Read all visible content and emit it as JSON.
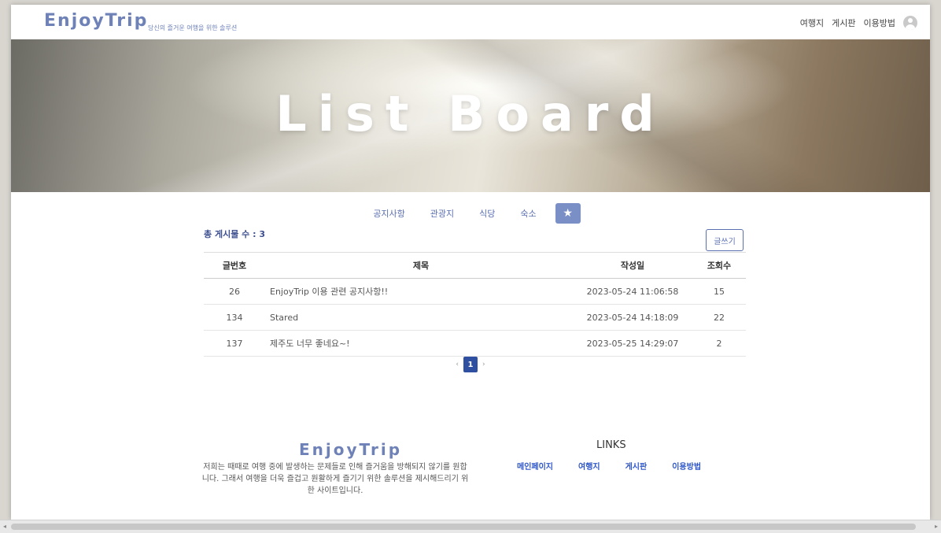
{
  "header": {
    "logo": "EnjoyTrip",
    "tagline": "당신의 즐거운 여행을 위한 솔루션",
    "nav": [
      "여행지",
      "게시판",
      "이용방법"
    ]
  },
  "hero": {
    "title": "List Board"
  },
  "tabs": [
    "공지사항",
    "관광지",
    "식당",
    "숙소"
  ],
  "board": {
    "count_label": "총 게시물 수 : 3",
    "write_label": "글쓰기",
    "columns": [
      "글번호",
      "제목",
      "작성일",
      "조회수"
    ],
    "rows": [
      {
        "no": "26",
        "title": "EnjoyTrip 이용 관련 공지사항!!",
        "date": "2023-05-24 11:06:58",
        "views": "15"
      },
      {
        "no": "134",
        "title": "Stared",
        "date": "2023-05-24 14:18:09",
        "views": "22"
      },
      {
        "no": "137",
        "title": "제주도 너무 좋네요~!",
        "date": "2023-05-25 14:29:07",
        "views": "2"
      }
    ]
  },
  "pagination": {
    "prev": "‹",
    "current": "1",
    "next": "›"
  },
  "footer": {
    "logo": "EnjoyTrip",
    "description": "저희는 때때로 여행 중에 발생하는 문제들로 인해 즐거움을 방해되지 않기를 원합니다. 그래서 여행을 더욱 즐겁고 원활하게 즐기기 위한 솔루션을 제시해드리기 위한 사이트입니다.",
    "links_title": "LINKS",
    "links": [
      "메인페이지",
      "여행지",
      "게시판",
      "이용방법"
    ]
  },
  "colors": {
    "accent": "#6f82b8",
    "primary": "#2f4fa0",
    "link": "#2f57c8"
  }
}
